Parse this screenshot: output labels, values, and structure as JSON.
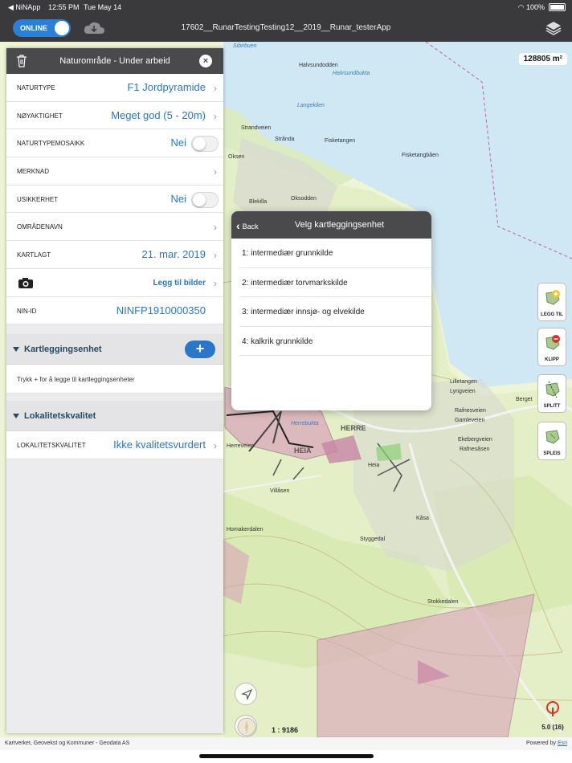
{
  "status_bar": {
    "back_app": "◀ NiNApp",
    "time": "12:55 PM",
    "date": "Tue May 14",
    "battery": "100%"
  },
  "top_bar": {
    "online_label": "ONLINE",
    "title": "17602__RunarTestingTesting12__2019__Runar_testerApp"
  },
  "map": {
    "area": "128805 m²",
    "scale": "1 : 9186",
    "zoom": "5.0 (16)",
    "labels": [
      "Halvsundodden",
      "Halvsundbukta",
      "Langekilen",
      "Strandveien",
      "Strånda",
      "Fisketangen",
      "Fisketangbåen",
      "Oksen",
      "Oksodden",
      "Blekilla",
      "Herreveien",
      "Herrebukta",
      "HERRE",
      "HEIA",
      "Heia",
      "Villåsen",
      "Homakerdalen",
      "Styggedal",
      "Stokkedalen",
      "Kåsa",
      "Lyngveien",
      "Rafnesveien",
      "Gamleveien",
      "Ekebergveien",
      "Rafnesåsen",
      "Lilletangen",
      "Berget",
      "Sibirbuen"
    ],
    "side_buttons": [
      "LEGG TIL",
      "KLIPP",
      "SPLITT",
      "SPLEIS"
    ]
  },
  "footer": {
    "attribution": "Kartverket, Geovekst og Kommuner - Geodata AS",
    "powered_prefix": "Powered by ",
    "powered_brand": "Esri"
  },
  "panel": {
    "title": "Naturområde - Under arbeid",
    "rows": [
      {
        "label": "NATURTYPE",
        "value": "F1 Jordpyramide"
      },
      {
        "label": "NØYAKTIGHET",
        "value": "Meget god (5 - 20m)"
      },
      {
        "label": "NATURTYPEMOSAIKK",
        "value": "Nei"
      },
      {
        "label": "MERKNAD",
        "value": ""
      },
      {
        "label": "USIKKERHET",
        "value": "Nei"
      },
      {
        "label": "OMRÅDENAVN",
        "value": ""
      },
      {
        "label": "KARTLAGT",
        "value": "21. mar. 2019"
      },
      {
        "label": "",
        "value": "Legg til bilder"
      },
      {
        "label": "NIN-ID",
        "value": "NINFP1910000350"
      }
    ],
    "section_mapping": "Kartleggingsenhet",
    "mapping_hint": "Trykk + for å legge til kartleggingsenheter",
    "section_quality": "Lokalitetskvalitet",
    "quality_row": {
      "label": "LOKALITETSKVALITET",
      "value": "Ikke kvalitetsvurdert"
    }
  },
  "popover": {
    "back": "Back",
    "title": "Velg kartleggingsenhet",
    "items": [
      "1: intermediær grunnkilde",
      "2: intermediær torvmarkskilde",
      "3: intermediær innsjø- og elvekilde",
      "4: kalkrik grunnkilde"
    ]
  },
  "colors": {
    "accent": "#2a76c9",
    "header": "#4a4a4c",
    "map_base": "#eef4d6",
    "polygon": "#d9a3b9"
  }
}
